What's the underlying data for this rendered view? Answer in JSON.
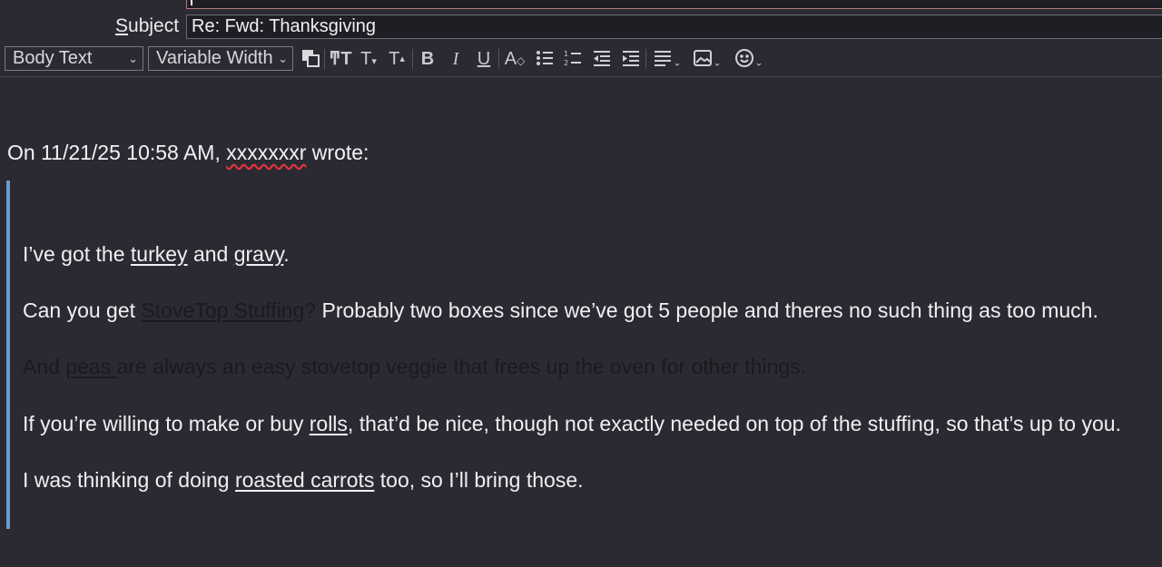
{
  "header": {
    "subject_label_first": "S",
    "subject_label_rest": "ubject",
    "subject_value": "Re: Fwd: Thanksgiving"
  },
  "toolbar": {
    "paragraph_format": "Body Text",
    "font_family": "Variable Width",
    "icons": [
      "text-color-icon",
      "font-size-icon",
      "smaller-text-icon",
      "larger-text-icon",
      "bold-icon",
      "italic-icon",
      "underline-icon",
      "text-style-icon",
      "bullet-list-icon",
      "numbered-list-icon",
      "outdent-icon",
      "indent-icon",
      "align-icon",
      "insert-image-icon",
      "emoji-icon"
    ]
  },
  "body": {
    "cite_prefix": "On 11/21/25 10:58 AM, ",
    "cite_name": "xxxxxxxr",
    "cite_suffix": " wrote:",
    "paragraphs": {
      "p1": {
        "a": "I’ve got the ",
        "b": "turkey",
        "c": " and ",
        "d": "gravy",
        "e": "."
      },
      "p2": {
        "a": "Can you get ",
        "b": "StoveTop Stuffing",
        "c": "?",
        "d": " Probably two boxes since we’ve got 5 people and theres no such thing as too much."
      },
      "p3": {
        "a": "And ",
        "b": "peas ",
        "c": "are always an easy stovetop veggie that frees up the oven for other things."
      },
      "p4": {
        "a": "If you’re willing to make or buy ",
        "b": "rolls",
        "c": ", that’d be nice, though not exactly needed on top of the stuffing, so that’s up to you."
      },
      "p5": {
        "a": "I was thinking of doing ",
        "b": "roasted carrots",
        "c": " too, so I’ll bring those."
      }
    }
  }
}
